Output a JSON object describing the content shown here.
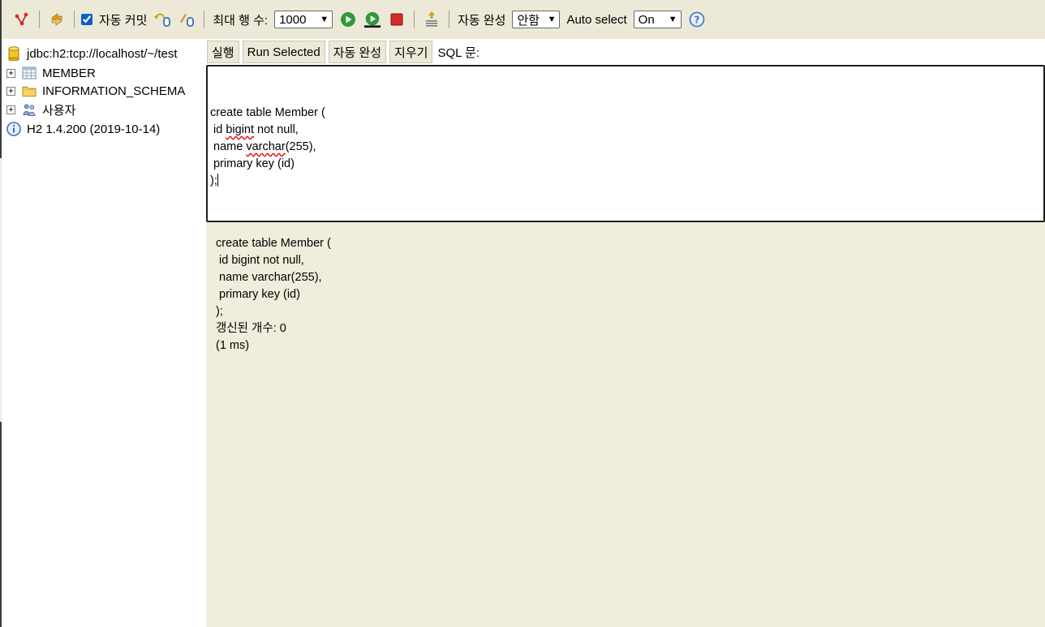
{
  "toolbar": {
    "autocommit_label": "자동 커밋",
    "autocommit_checked": true,
    "max_rows_label": "최대 행 수:",
    "max_rows_value": "1000",
    "autocomplete_label": "자동 완성",
    "autocomplete_value": "안함",
    "auto_select_label": "Auto select",
    "auto_select_value": "On"
  },
  "tree": {
    "connection": "jdbc:h2:tcp://localhost/~/test",
    "items": [
      {
        "label": "MEMBER",
        "icon": "table-icon"
      },
      {
        "label": "INFORMATION_SCHEMA",
        "icon": "folder-icon"
      },
      {
        "label": "사용자",
        "icon": "users-icon"
      }
    ],
    "version": "H2 1.4.200 (2019-10-14)"
  },
  "actions": {
    "run": "실행",
    "run_selected": "Run Selected",
    "autocomplete": "자동 완성",
    "clear": "지우기",
    "sql_label": "SQL 문:"
  },
  "editor": {
    "lines": [
      {
        "parts": [
          {
            "t": "create table Member ("
          }
        ]
      },
      {
        "parts": [
          {
            "t": " id "
          },
          {
            "t": "bigint",
            "spell": true
          },
          {
            "t": " not null,"
          }
        ]
      },
      {
        "parts": [
          {
            "t": " name "
          },
          {
            "t": "varchar",
            "spell": true
          },
          {
            "t": "(255),"
          }
        ]
      },
      {
        "parts": [
          {
            "t": " primary key (id)"
          }
        ]
      },
      {
        "parts": [
          {
            "t": ");"
          }
        ],
        "caret": true
      }
    ]
  },
  "output": {
    "text": "create table Member (\n id bigint not null,\n name varchar(255),\n primary key (id)\n);\n갱신된 개수: 0\n(1 ms)"
  },
  "colors": {
    "toolbar_bg": "#ece9d8",
    "result_bg": "#f1eddc",
    "run_green": "#2e9b3a",
    "stop_red": "#d42a2a",
    "help_blue": "#3a6fc4"
  }
}
